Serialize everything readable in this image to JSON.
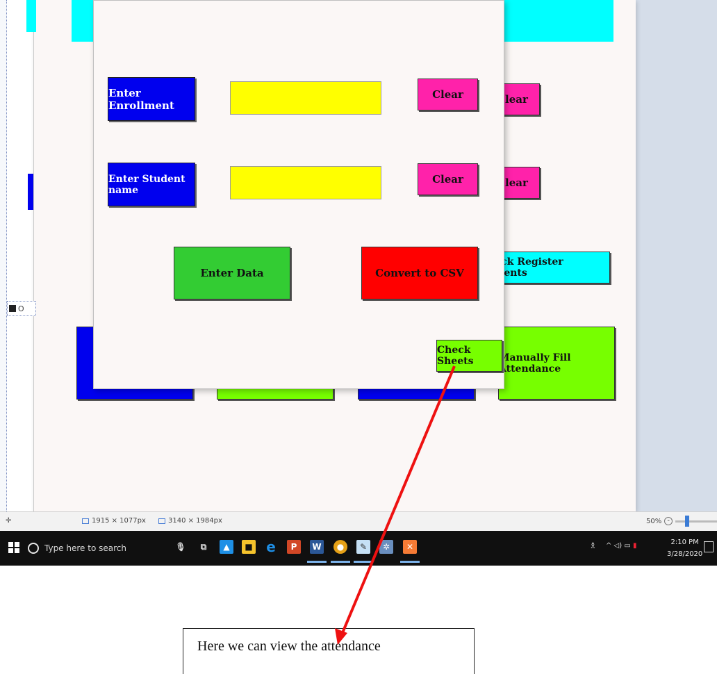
{
  "dialog": {
    "enrollment_label": "Enter Enrollment",
    "enrollment_value": "",
    "clear1_label": "Clear",
    "student_name_label": "Enter Student name",
    "student_name_value": "",
    "clear2_label": "Clear",
    "enter_data_label": "Enter Data",
    "convert_csv_label": "Convert to CSV",
    "check_sheets_label": "Check Sheets"
  },
  "back_window": {
    "clear1_partial": "lear",
    "clear2_partial": "lear",
    "check_register_label": "Check Register students",
    "manual_fill_label": "Manually Fill Attendance"
  },
  "statusbar": {
    "selection_size": "1915 × 1077px",
    "image_size": "3140 × 1984px",
    "zoom": "50%"
  },
  "taskbar": {
    "search_placeholder": "Type here to search",
    "time": "2:10 PM",
    "date": "3/28/2020",
    "icons": [
      "task-view-icon",
      "store-icon",
      "file-explorer-icon",
      "edge-icon",
      "powerpoint-icon",
      "word-icon",
      "chrome-icon",
      "paint-icon",
      "settings-icon",
      "xampp-icon"
    ]
  },
  "callout": {
    "text": "Here we can view the attendance"
  },
  "colors": {
    "label_blue": "#0000ee",
    "field_yellow": "#ffff00",
    "clear_pink": "#ff22aa",
    "enter_green": "#33cc33",
    "convert_red": "#ff0000",
    "sheets_lime": "#77ff00",
    "register_cyan": "#00ffff",
    "arrow_red": "#ee1111"
  }
}
